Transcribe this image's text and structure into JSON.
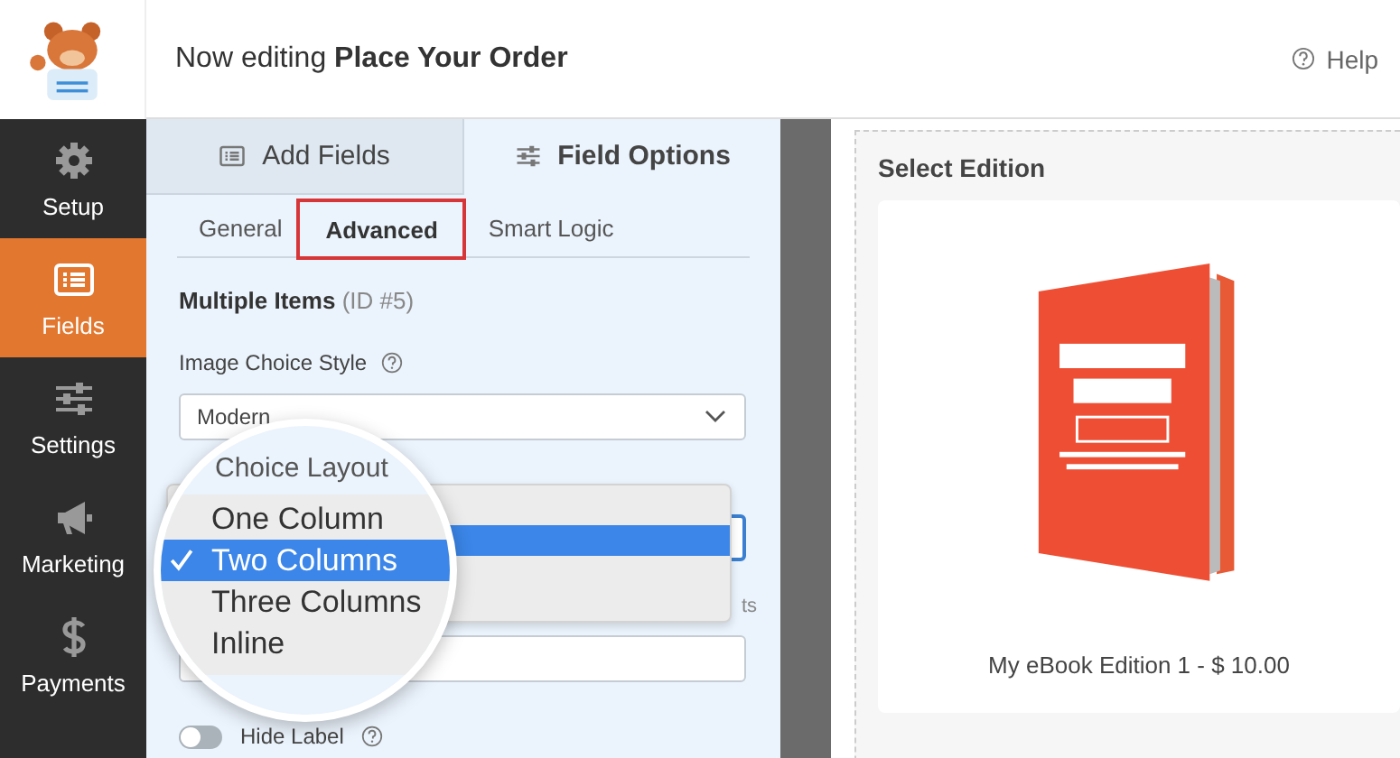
{
  "header": {
    "title": "Now editing **Place Your Order**",
    "help": "Help"
  },
  "sidebar": {
    "items": [
      {
        "label": "Setup",
        "kind": "gear",
        "selected": false
      },
      {
        "label": "Fields",
        "kind": "list",
        "selected": true
      },
      {
        "label": "Settings",
        "kind": "sliders",
        "selected": false
      },
      {
        "label": "Marketing",
        "kind": "megaphone",
        "selected": false
      },
      {
        "label": "Payments",
        "kind": "dollar",
        "selected": false
      }
    ]
  },
  "panel_tabs": [
    {
      "label": "Add Fields",
      "kind": "list",
      "selected": false
    },
    {
      "label": "Field Options",
      "kind": "sliders",
      "selected": true
    }
  ],
  "sub_tabs": [
    {
      "label": "General",
      "selected": false
    },
    {
      "label": "Advanced",
      "selected": true
    },
    {
      "label": "Smart Logic",
      "selected": false
    }
  ],
  "field": {
    "name": "Multiple Items",
    "id": "(ID #5)"
  },
  "image_choice_style": {
    "label": "Image Choice Style",
    "value": "Modern"
  },
  "choice_layout": {
    "label": "Choice Layout",
    "options": [
      {
        "label": "One Column",
        "selected": false
      },
      {
        "label": "Two Columns",
        "selected": true
      },
      {
        "label": "Three Columns",
        "selected": false
      },
      {
        "label": "Inline",
        "selected": false
      }
    ]
  },
  "partial_label": "ts",
  "hide_label": {
    "label": "Hide Label",
    "on": false
  },
  "preview": {
    "title": "Select Edition",
    "caption": "My eBook Edition 1 - $ 10.00"
  }
}
